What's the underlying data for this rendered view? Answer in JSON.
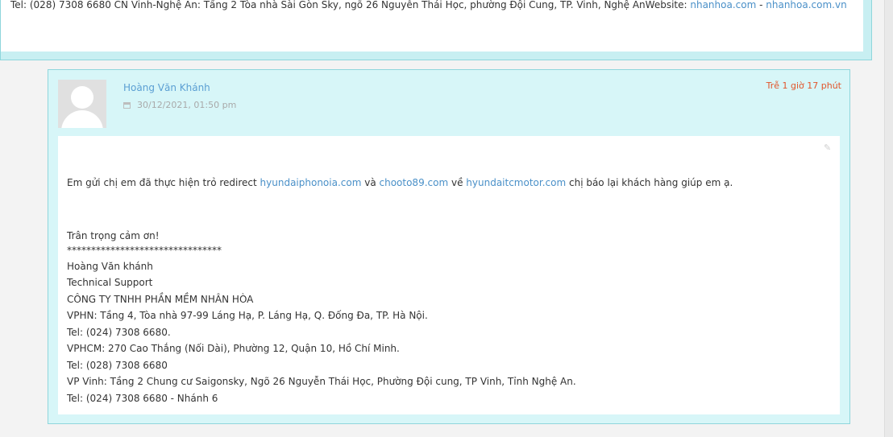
{
  "previous_reply": {
    "text": "Tel: (028) 7308 6680 CN Vinh-Nghệ An: Tầng 2 Tòa nhà Sài Gòn Sky, ngõ 26 Nguyễn Thái Học, phường Đội Cung, TP. Vinh, Nghệ AnWebsite: ",
    "link1": "nhanhoa.com",
    "separator": " - ",
    "link2": "nhanhoa.com.vn"
  },
  "reply": {
    "author": "Hoàng Văn Khánh",
    "date": "30/12/2021, 01:50 pm",
    "late_label": "Trễ 1 giờ 17 phút",
    "message": {
      "part1": "Em gửi chị em đã thực hiện trỏ redirect ",
      "link1": "hyundaiphonoia.com",
      "part2": " và ",
      "link2": "chooto89.com",
      "part3": " về ",
      "link3": "hyundaitcmotor.com",
      "part4": " chị báo lại khách hàng giúp em ạ."
    },
    "signature": {
      "greeting": "Trân trọng cảm ơn!",
      "stars": "********************************",
      "lines": [
        "Hoàng Văn khánh",
        "Technical Support",
        "CÔNG TY TNHH PHẦN MỀM NHÂN HÒA",
        "VPHN: Tầng 4, Tòa nhà 97-99 Láng Hạ, P. Láng Hạ, Q. Đống Đa, TP. Hà Nội.",
        "Tel: (024) 7308 6680.",
        "VPHCM: 270 Cao Thắng (Nối Dài), Phường 12, Quận 10, Hồ Chí Minh.",
        "Tel: (028) 7308 6680",
        "VP Vinh: Tầng 2 Chung cư Saigonsky, Ngõ 26 Nguyễn Thái Học, Phường Đội cung, TP Vinh, Tỉnh Nghệ An.",
        "Tel: (024) 7308 6680 - Nhánh 6"
      ]
    }
  },
  "colors": {
    "link": "#4a90c8",
    "late": "#e2552b",
    "card_bg": "#d7f6f8",
    "card_border": "#8fd6dc"
  },
  "icons": [
    "calendar-icon",
    "edit-icon",
    "avatar-placeholder"
  ]
}
